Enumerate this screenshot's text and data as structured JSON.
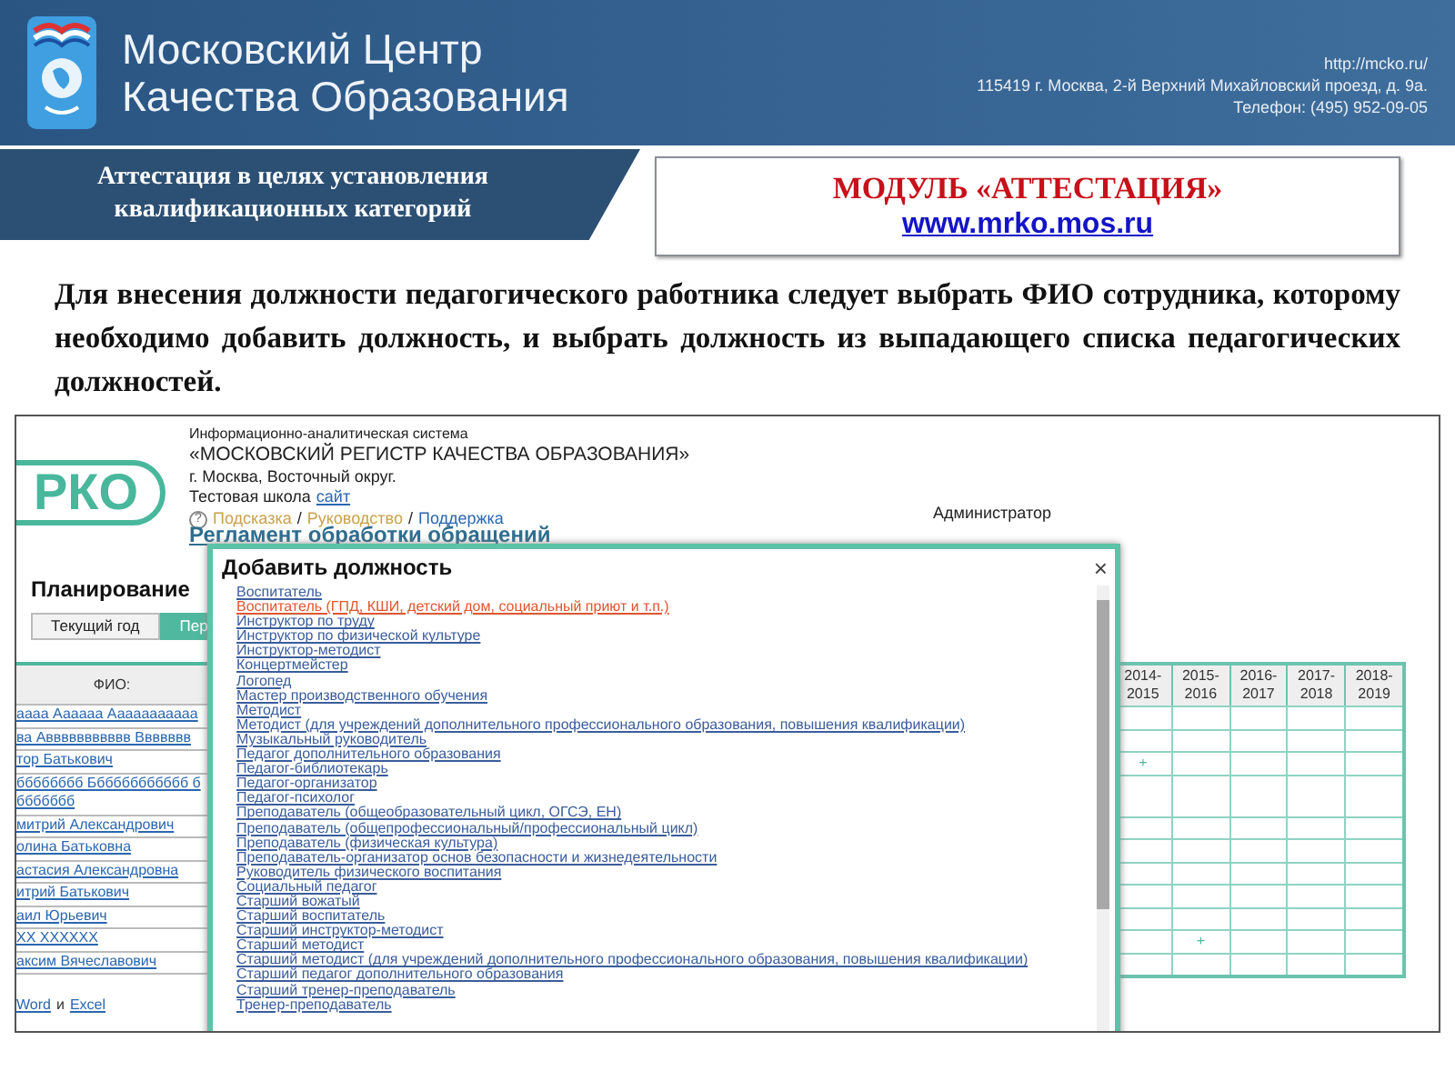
{
  "header": {
    "org_name_lines": [
      "Московский Центр",
      "Качества Образования"
    ],
    "contact_lines": [
      "http://mcko.ru/",
      "115419 г. Москва, 2-й Верхний Михайловский проезд, д. 9а.",
      "Телефон: (495) 952-09-05"
    ]
  },
  "banner": {
    "section_title_lines": [
      "Аттестация в целях установления",
      "квалификационных категорий"
    ],
    "module_title": "МОДУЛЬ «АТТЕСТАЦИЯ»",
    "module_link": "www.mrko.mos.ru"
  },
  "instruction": "Для внесения должности педагогического работника следует выбрать ФИО сотрудника, которому необходимо добавить должность, и выбрать должность из выпадающего списка педагогических должностей.",
  "screenshot": {
    "logo_text": "РКО",
    "system_caption": "Информационно-аналитическая система",
    "system_name": "«МОСКОВСКИЙ РЕГИСТР КАЧЕСТВА ОБРАЗОВАНИЯ»",
    "location": "г. Москва, Восточный округ.",
    "school": "Тестовая школа",
    "school_link": "сайт",
    "help_symbol": "?",
    "help_links": [
      {
        "label": "Подсказка",
        "kind": "guide"
      },
      {
        "label": "Руководство",
        "kind": "guide"
      },
      {
        "label": "Поддержка",
        "kind": "support"
      }
    ],
    "help_separator": "/",
    "user_role": "Администратор",
    "regulation_link": "Регламент обработки обращений",
    "section_title": "Планирование",
    "tabs": [
      {
        "label": "Текущий год",
        "selected": false
      },
      {
        "label": "Пер",
        "selected": true
      }
    ],
    "table": {
      "name_header": "ФИО:",
      "year_headers": [
        "2014-\n2015",
        "2015-\n2016",
        "2016-\n2017",
        "2017-\n2018",
        "2018-\n2019"
      ],
      "mark_symbol": "+",
      "rows": [
        {
          "name": "аааа Аааааа Ааааааааааа",
          "marked": [
            false,
            false,
            false,
            false,
            false
          ]
        },
        {
          "name": "ва Аввввввввввв Ввввввв",
          "marked": [
            false,
            false,
            false,
            false,
            false
          ]
        },
        {
          "name": "тор Батькович",
          "marked": [
            true,
            false,
            false,
            false,
            false
          ]
        },
        {
          "name": "бббббббб Бббббббббббб бббббббб",
          "marked": [
            false,
            false,
            false,
            false,
            false
          ]
        },
        {
          "name": "митрий Александрович",
          "marked": [
            false,
            false,
            false,
            false,
            false
          ]
        },
        {
          "name": "олина Батьковна",
          "marked": [
            false,
            false,
            false,
            false,
            false
          ]
        },
        {
          "name": "астасия Александровна",
          "marked": [
            false,
            false,
            false,
            false,
            false
          ]
        },
        {
          "name": "итрий Батькович",
          "marked": [
            false,
            false,
            false,
            false,
            false
          ]
        },
        {
          "name": "аил Юрьевич",
          "marked": [
            false,
            false,
            false,
            false,
            false
          ]
        },
        {
          "name": "ХХ ХХХХХХ",
          "marked": [
            false,
            true,
            false,
            false,
            false
          ]
        },
        {
          "name": "аксим Вячеславович",
          "marked": [
            false,
            false,
            false,
            false,
            false
          ]
        }
      ]
    },
    "export": {
      "links": [
        "Word",
        "Excel"
      ],
      "conjunction": "и"
    },
    "dialog": {
      "title": "Добавить должность",
      "close_symbol": "×",
      "positions": [
        {
          "label": "Воспитатель",
          "selected": false
        },
        {
          "label": "Воспитатель (ГПД, КШИ, детский дом, социальный приют и т.п.)",
          "selected": true
        },
        {
          "label": "Инструктор по труду",
          "selected": false
        },
        {
          "label": "Инструктор по физической культуре",
          "selected": false
        },
        {
          "label": "Инструктор-методист",
          "selected": false
        },
        {
          "label": "Концертмейстер",
          "selected": false
        },
        {
          "label": "Логопед",
          "selected": false
        },
        {
          "label": "Мастер производственного обучения",
          "selected": false
        },
        {
          "label": "Методист",
          "selected": false
        },
        {
          "label": "Методист (для учреждений дополнительного профессионального образования, повышения квалификации)",
          "selected": false
        },
        {
          "label": "Музыкальный руководитель",
          "selected": false
        },
        {
          "label": "Педагог дополнительного образования",
          "selected": false
        },
        {
          "label": "Педагог-библиотекарь",
          "selected": false
        },
        {
          "label": "Педагог-организатор",
          "selected": false
        },
        {
          "label": "Педагог-психолог",
          "selected": false
        },
        {
          "label": "Преподаватель (общеобразовательный цикл, ОГСЭ, ЕН)",
          "selected": false
        },
        {
          "label": "Преподаватель (общепрофессиональный/профессиональный цикл)",
          "selected": false
        },
        {
          "label": "Преподаватель (физическая культура)",
          "selected": false
        },
        {
          "label": "Преподаватель-организатор основ безопасности и жизнедеятельности",
          "selected": false
        },
        {
          "label": "Руководитель физического воспитания",
          "selected": false
        },
        {
          "label": "Социальный педагог",
          "selected": false
        },
        {
          "label": "Старший вожатый",
          "selected": false
        },
        {
          "label": "Старший воспитатель",
          "selected": false
        },
        {
          "label": "Старший инструктор-методист",
          "selected": false
        },
        {
          "label": "Старший методист",
          "selected": false
        },
        {
          "label": "Старший методист (для учреждений дополнительного профессионального образования, повышения квалификации)",
          "selected": false
        },
        {
          "label": "Старший педагог дополнительного образования",
          "selected": false
        },
        {
          "label": "Старший тренер-преподаватель",
          "selected": false
        },
        {
          "label": "Тренер-преподаватель",
          "selected": false
        }
      ]
    }
  }
}
